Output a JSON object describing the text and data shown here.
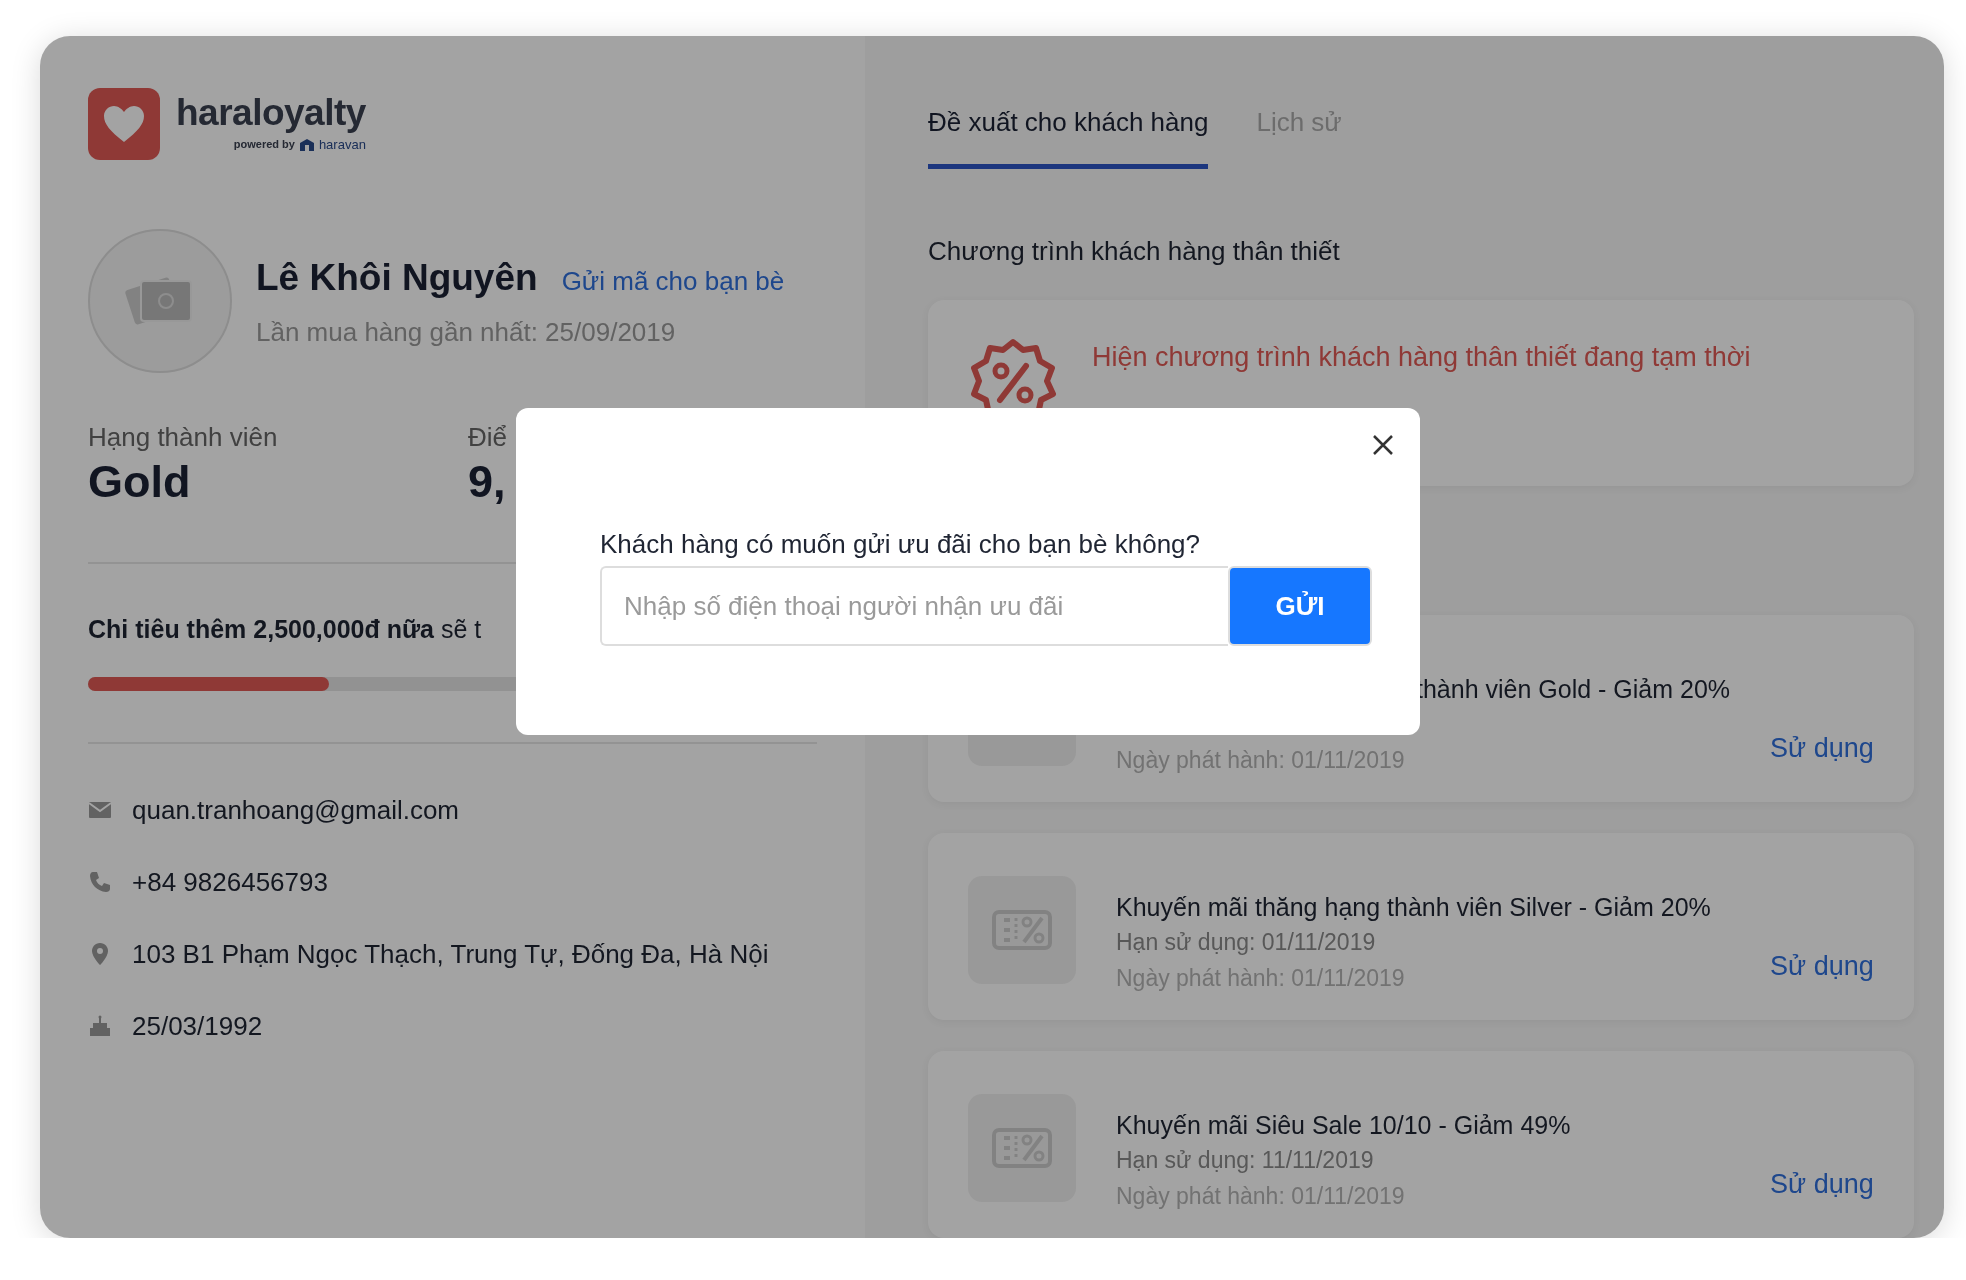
{
  "brand": {
    "name": "haraloyalty",
    "powered_by": "powered by",
    "partner": "haravan"
  },
  "customer": {
    "name": "Lê Khôi Nguyên",
    "send_link": "Gửi mã cho bạn bè",
    "last_purchase": "Lần mua hàng gần nhất: 25/09/2019"
  },
  "stats": [
    {
      "label": "Hạng thành viên",
      "value": "Gold"
    },
    {
      "label": "Điể",
      "value": "9,"
    }
  ],
  "progress": {
    "text": "**Chi tiêu thêm 2,500,000đ nữa** sẽ t",
    "level": 0.33
  },
  "contacts": [
    {
      "kind": "email",
      "text": "quan.tranhoang@gmail.com"
    },
    {
      "kind": "phone",
      "text": "+84 9826456793"
    },
    {
      "kind": "address",
      "text": "103 B1 Phạm Ngọc Thạch, Trung Tự, Đống Đa, Hà Nội"
    },
    {
      "kind": "birthday",
      "text": "25/03/1992"
    }
  ],
  "tabs": [
    {
      "label": "Đề xuất cho khách hàng",
      "selected": true
    },
    {
      "label": "Lịch sử",
      "selected": false
    }
  ],
  "loyalty": {
    "heading": "Chương trình khách hàng thân thiết",
    "notice": "Hiện chương trình khách hàng thân thiết đang tạm thời"
  },
  "offers": [
    {
      "kind": "covered",
      "title": "thành viên Gold - Giảm 20%",
      "issued": "Ngày phát hành: 01/11/2019",
      "action": "Sử dụng"
    },
    {
      "kind": "full",
      "title": "Khuyến mãi thăng hạng thành viên Silver - Giảm 20%",
      "expiry": "Hạn sử dụng: 01/11/2019",
      "issued": "Ngày phát hành: 01/11/2019",
      "action": "Sử dụng"
    },
    {
      "kind": "full",
      "title": "Khuyến mãi Siêu Sale 10/10 - Giảm 49%",
      "expiry": "Hạn sử dụng: 11/11/2019",
      "issued": "Ngày phát hành: 01/11/2019",
      "action": "Sử dụng"
    }
  ],
  "modal": {
    "question": "Khách hàng có muốn gửi ưu đãi cho bạn bè không?",
    "placeholder": "Nhập số điện thoại người nhận ưu đãi",
    "submit": "GỬI"
  }
}
